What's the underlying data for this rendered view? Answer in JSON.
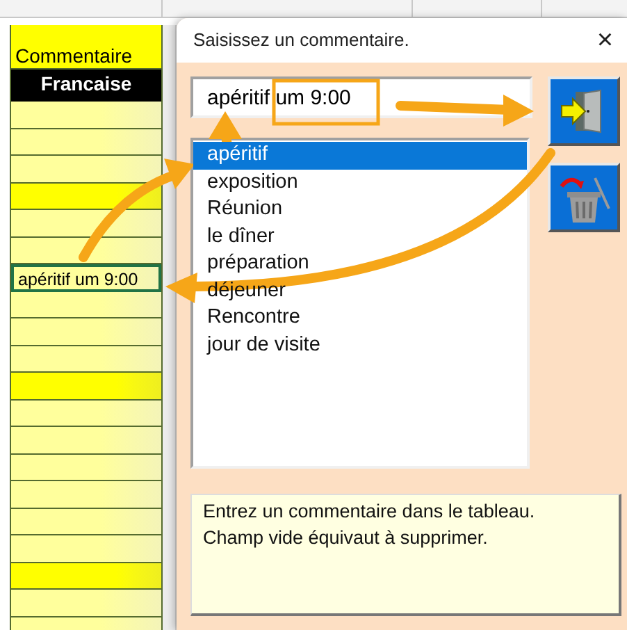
{
  "spreadsheet": {
    "header": "Commentaire",
    "subheader": "Francaise",
    "rows": [
      {
        "highlight": false
      },
      {
        "highlight": false
      },
      {
        "highlight": false
      },
      {
        "highlight": true
      },
      {
        "highlight": false
      },
      {
        "highlight": false
      },
      {
        "highlight": false,
        "text": "apéritif um 9:00",
        "selected": true
      },
      {
        "highlight": false
      },
      {
        "highlight": false
      },
      {
        "highlight": false
      },
      {
        "highlight": true
      },
      {
        "highlight": false
      },
      {
        "highlight": false
      },
      {
        "highlight": false
      },
      {
        "highlight": false
      },
      {
        "highlight": false
      },
      {
        "highlight": false
      },
      {
        "highlight": true
      },
      {
        "highlight": false
      },
      {
        "highlight": false
      }
    ]
  },
  "dialog": {
    "title": "Saisissez un commentaire.",
    "close": "×",
    "input": {
      "value": "apéritif um 9:00"
    },
    "list": [
      {
        "label": "apéritif",
        "selected": true
      },
      {
        "label": "exposition",
        "selected": false
      },
      {
        "label": "Réunion",
        "selected": false
      },
      {
        "label": "le dîner",
        "selected": false
      },
      {
        "label": "préparation",
        "selected": false
      },
      {
        "label": "déjeuner",
        "selected": false
      },
      {
        "label": "Rencontre",
        "selected": false
      },
      {
        "label": "jour de visite",
        "selected": false
      }
    ],
    "buttons": [
      {
        "kind": "exit"
      },
      {
        "kind": "delete"
      }
    ],
    "info": "Entrez un commentaire dans le tableau.\nChamp vide équivaut à supprimer."
  }
}
